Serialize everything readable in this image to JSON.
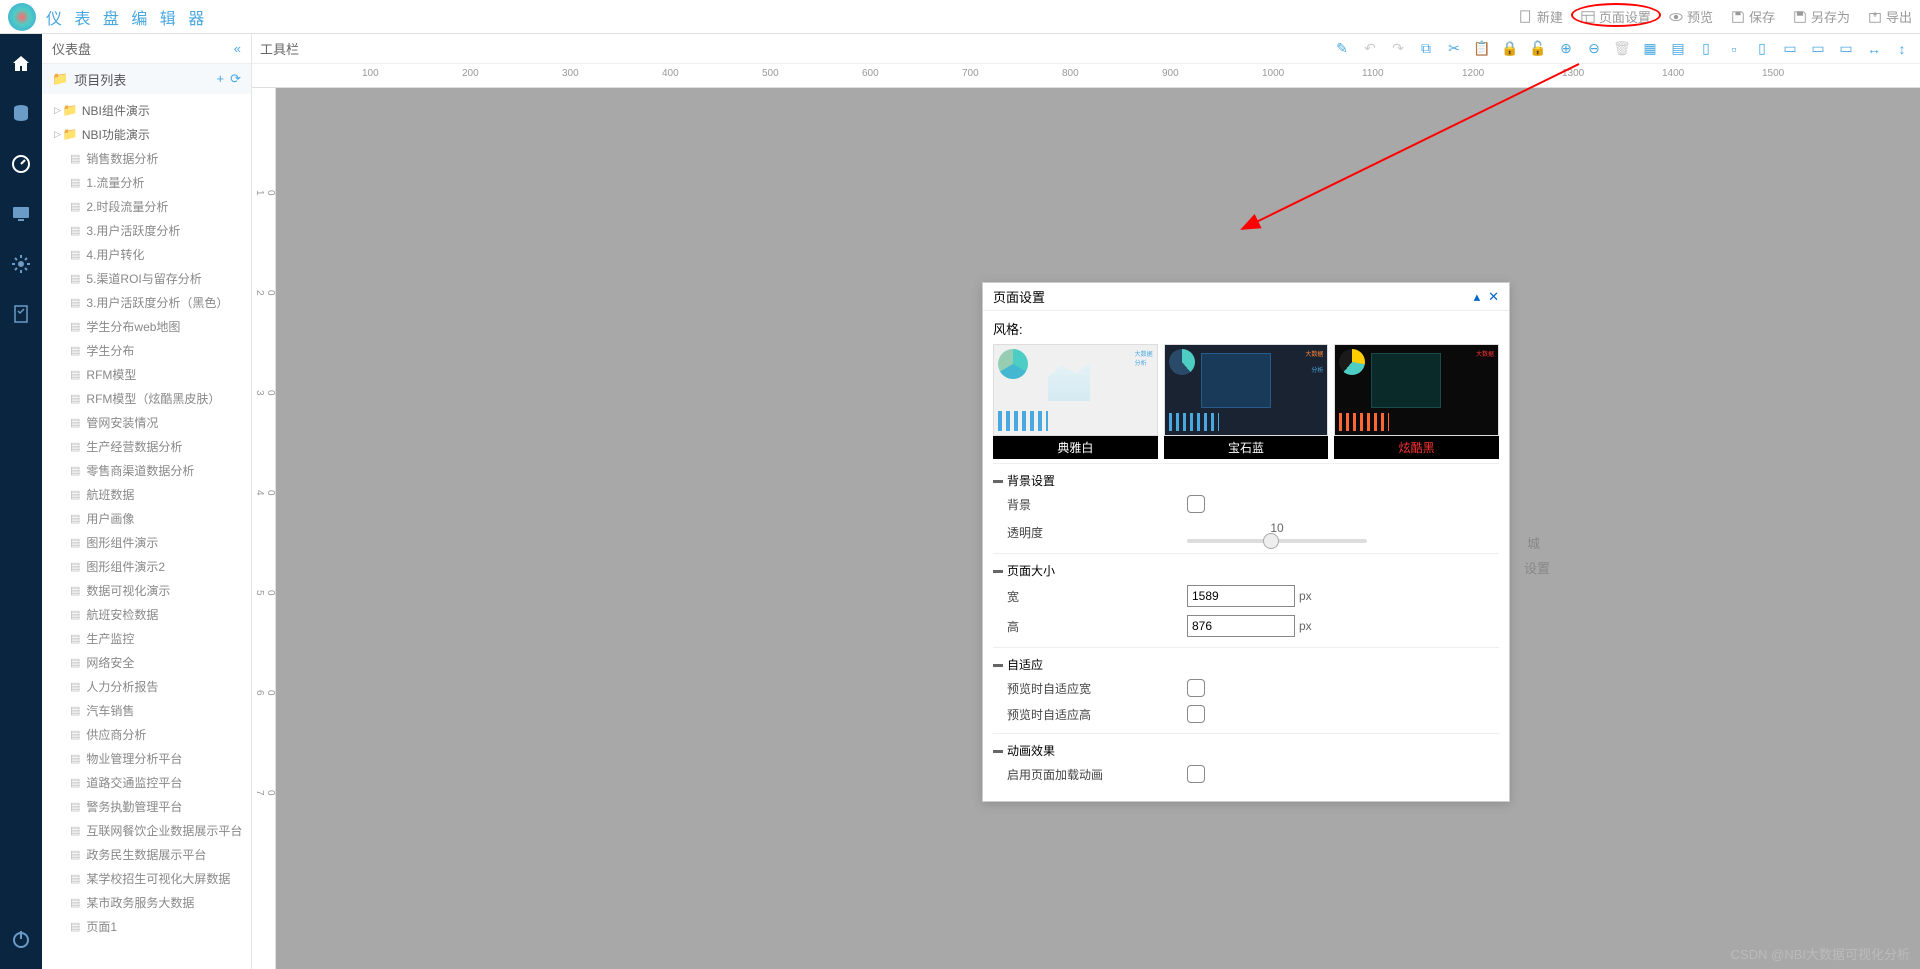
{
  "app": {
    "title": "仪 表 盘 编 辑 器"
  },
  "top_actions": {
    "new": "新建",
    "page_settings": "页面设置",
    "preview": "预览",
    "save": "保存",
    "save_as": "另存为",
    "export": "导出"
  },
  "left_panel": {
    "title": "仪表盘",
    "project_list": "项目列表"
  },
  "tree": {
    "folders": [
      {
        "name": "NBI组件演示"
      },
      {
        "name": "NBI功能演示"
      }
    ],
    "files": [
      "销售数据分析",
      "1.流量分析",
      "2.时段流量分析",
      "3.用户活跃度分析",
      "4.用户转化",
      "5.渠道ROI与留存分析",
      "3.用户活跃度分析（黑色）",
      "学生分布web地图",
      "学生分布",
      "RFM模型",
      "RFM模型（炫酷黑皮肤）",
      "管网安装情况",
      "生产经营数据分析",
      "零售商渠道数据分析",
      "航班数据",
      "用户画像",
      "图形组件演示",
      "图形组件演示2",
      "数据可视化演示",
      "航班安检数据",
      "生产监控",
      "网络安全",
      "人力分析报告",
      "汽车销售",
      "供应商分析",
      "物业管理分析平台",
      "道路交通监控平台",
      "警务执勤管理平台",
      "互联网餐饮企业数据展示平台",
      "政务民生数据展示平台",
      "某学校招生可视化大屏数据",
      "某市政务服务大数据",
      "页面1"
    ]
  },
  "toolbar": {
    "label": "工具栏"
  },
  "ruler_ticks_h": [
    100,
    200,
    300,
    400,
    500,
    600,
    700,
    800,
    900,
    1000,
    1100,
    1200,
    1300,
    1400,
    1500
  ],
  "ruler_ticks_v": [
    100,
    200,
    300,
    400,
    500,
    600,
    700
  ],
  "canvas": {
    "bg_text1": "城",
    "bg_text2": "设置"
  },
  "dialog": {
    "title": "页面设置",
    "style_label": "风格:",
    "themes": [
      {
        "name": "典雅白",
        "type": "light"
      },
      {
        "name": "宝石蓝",
        "type": "dark"
      },
      {
        "name": "炫酷黑",
        "type": "black",
        "red": true
      }
    ],
    "sections": {
      "bg": {
        "title": "背景设置",
        "bg_label": "背景",
        "opacity_label": "透明度",
        "opacity_value": "10"
      },
      "size": {
        "title": "页面大小",
        "width_label": "宽",
        "width_value": "1589",
        "height_label": "高",
        "height_value": "876",
        "unit": "px"
      },
      "adaptive": {
        "title": "自适应",
        "fit_w": "预览时自适应宽",
        "fit_h": "预览时自适应高"
      },
      "anim": {
        "title": "动画效果",
        "enable": "启用页面加载动画"
      }
    }
  },
  "watermark": "CSDN @NBI大数据可视化分析"
}
